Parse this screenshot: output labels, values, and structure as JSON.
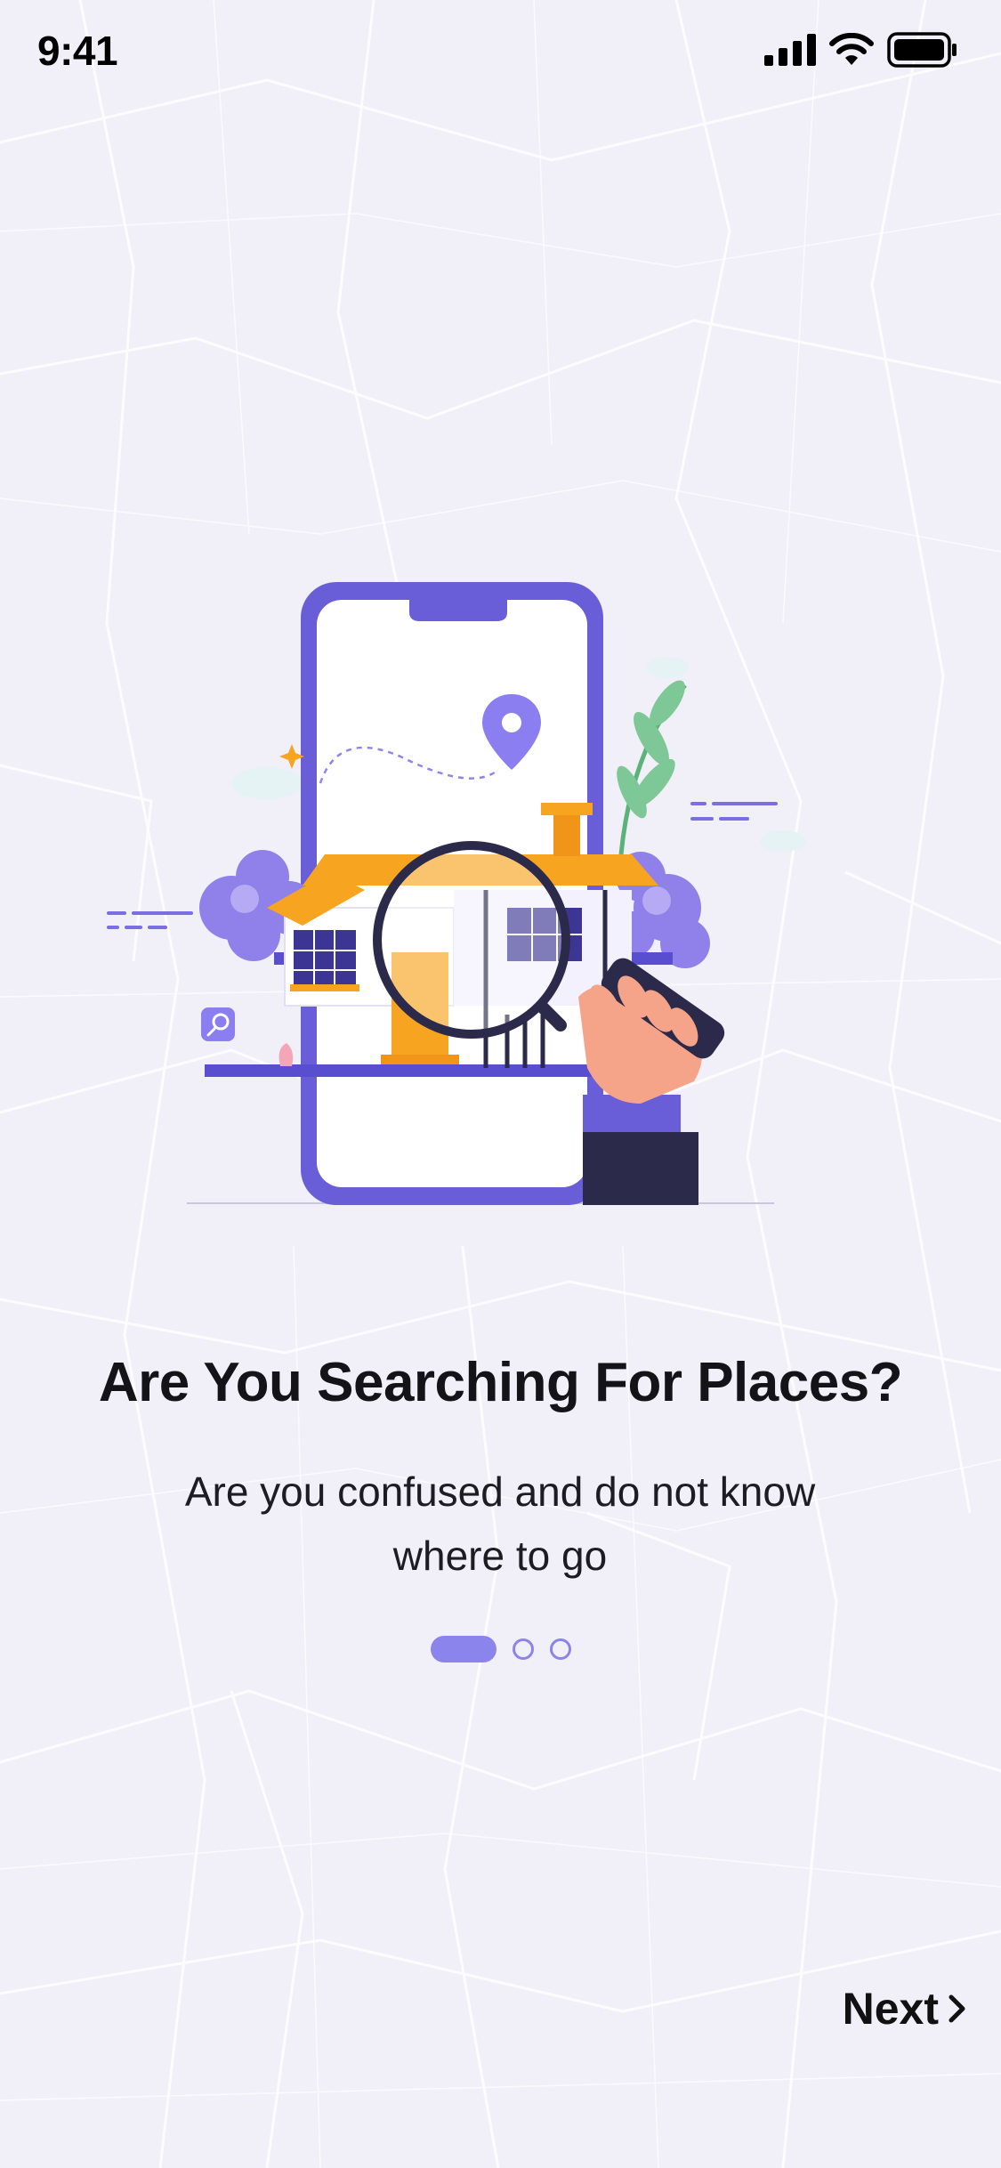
{
  "status_bar": {
    "time": "9:41",
    "icons": [
      "signal-icon",
      "wifi-icon",
      "battery-icon"
    ]
  },
  "illustration": {
    "icons": [
      "phone-icon",
      "location-pin-icon",
      "house-icon",
      "magnifier-icon",
      "hand-icon",
      "plant-icon",
      "search-badge-icon",
      "tree-icon",
      "cloud-icon",
      "sparkle-icon"
    ]
  },
  "content": {
    "title": "Are You Searching For Places?",
    "subtitle_line1": "Are you confused and do not know",
    "subtitle_line2": "where to go"
  },
  "pager": {
    "total": 3,
    "active_index": 0
  },
  "footer": {
    "next_label": "Next",
    "next_icon": "chevron-right-icon"
  },
  "colors": {
    "background": "#f1f0f8",
    "accent": "#8a84ec",
    "phone_frame": "#6f62d9",
    "house_roof": "#f7a521"
  }
}
